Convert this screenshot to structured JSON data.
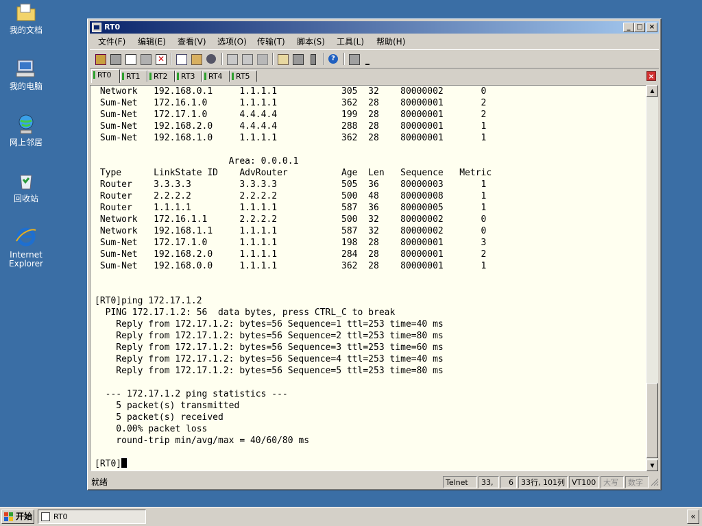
{
  "desktop": {
    "icons": [
      {
        "label": "我的文档",
        "icon": "my-documents-icon"
      },
      {
        "label": "我的电脑",
        "icon": "my-computer-icon"
      },
      {
        "label": "网上邻居",
        "icon": "network-places-icon"
      },
      {
        "label": "回收站",
        "icon": "recycle-bin-icon"
      },
      {
        "label": "Internet Explorer",
        "icon": "internet-explorer-icon"
      }
    ]
  },
  "window": {
    "title": "RT0",
    "min_label": "_",
    "max_label": "□",
    "close_label": "×"
  },
  "menu": [
    "文件(F)",
    "编辑(E)",
    "查看(V)",
    "选项(O)",
    "传输(T)",
    "脚本(S)",
    "工具(L)",
    "帮助(H)"
  ],
  "tabs": [
    "RT0",
    "RT1",
    "RT2",
    "RT3",
    "RT4",
    "RT5"
  ],
  "tab_close_label": "×",
  "terminal": {
    "lines": [
      " Network   192.168.0.1     1.1.1.1            305  32    80000002       0",
      " Sum-Net   172.16.1.0      1.1.1.1            362  28    80000001       2",
      " Sum-Net   172.17.1.0      4.4.4.4            199  28    80000001       2",
      " Sum-Net   192.168.2.0     4.4.4.4            288  28    80000001       1",
      " Sum-Net   192.168.1.0     1.1.1.1            362  28    80000001       1",
      "",
      "                         Area: 0.0.0.1",
      " Type      LinkState ID    AdvRouter          Age  Len   Sequence   Metric",
      " Router    3.3.3.3         3.3.3.3            505  36    80000003       1",
      " Router    2.2.2.2         2.2.2.2            500  48    80000008       1",
      " Router    1.1.1.1         1.1.1.1            587  36    80000005       1",
      " Network   172.16.1.1      2.2.2.2            500  32    80000002       0",
      " Network   192.168.1.1     1.1.1.1            587  32    80000002       0",
      " Sum-Net   172.17.1.0      1.1.1.1            198  28    80000001       3",
      " Sum-Net   192.168.2.0     1.1.1.1            284  28    80000001       2",
      " Sum-Net   192.168.0.0     1.1.1.1            362  28    80000001       1",
      "",
      "",
      "[RT0]ping 172.17.1.2",
      "  PING 172.17.1.2: 56  data bytes, press CTRL_C to break",
      "    Reply from 172.17.1.2: bytes=56 Sequence=1 ttl=253 time=40 ms",
      "    Reply from 172.17.1.2: bytes=56 Sequence=2 ttl=253 time=80 ms",
      "    Reply from 172.17.1.2: bytes=56 Sequence=3 ttl=253 time=60 ms",
      "    Reply from 172.17.1.2: bytes=56 Sequence=4 ttl=253 time=40 ms",
      "    Reply from 172.17.1.2: bytes=56 Sequence=5 ttl=253 time=80 ms",
      "",
      "  --- 172.17.1.2 ping statistics ---",
      "    5 packet(s) transmitted",
      "    5 packet(s) received",
      "    0.00% packet loss",
      "    round-trip min/avg/max = 40/60/80 ms",
      "",
      "[RT0]"
    ]
  },
  "status": {
    "ready": "就绪",
    "protocol": "Telnet",
    "row": "33,",
    "col": "6",
    "size": "33行, 101列",
    "emulation": "VT100",
    "caps": "大写",
    "num": "数字"
  },
  "taskbar": {
    "start_label": "开始",
    "task_label": "RT0",
    "tray_label": "«"
  }
}
